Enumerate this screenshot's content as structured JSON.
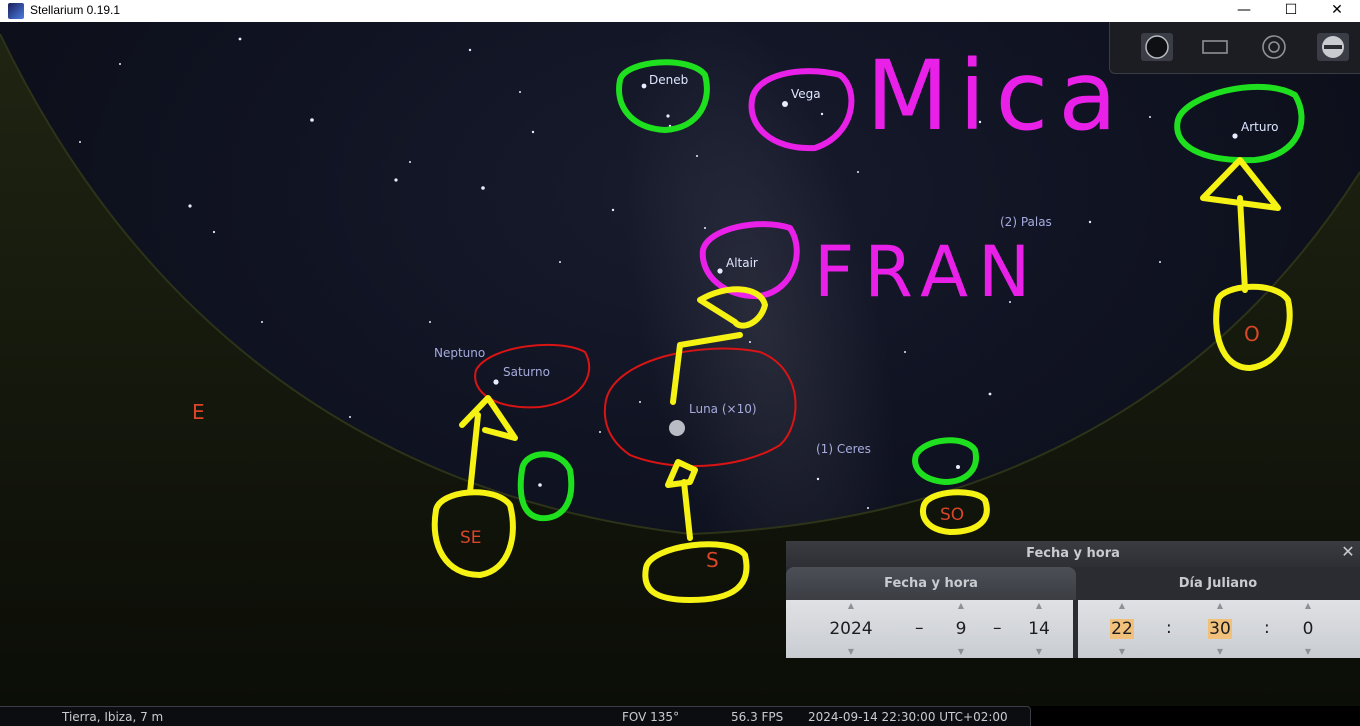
{
  "window": {
    "title": "Stellarium 0.19.1",
    "minimize": "—",
    "maximize": "☐",
    "close": "✕"
  },
  "colors": {
    "sky": "#0f1220",
    "ground": "#14180c",
    "cardinal": "#d9462a",
    "highlight": "#f1c07a"
  },
  "sky_labels": {
    "deneb": "Deneb",
    "vega": "Vega",
    "arturo": "Arturo",
    "palas": "(2) Palas",
    "altair": "Altair",
    "neptuno": "Neptuno",
    "saturno": "Saturno",
    "luna": "Luna (×10)",
    "ceres": "(1) Ceres"
  },
  "cardinals": {
    "e": "E",
    "se": "SE",
    "s": "S",
    "so": "SO",
    "o": "O"
  },
  "handwriting": {
    "mica": "Mica",
    "fran": "FRAN"
  },
  "toolbar": {
    "icons": [
      "sky-view-icon",
      "screen-frame-icon",
      "target-icon",
      "settings-key-icon"
    ]
  },
  "dialog": {
    "title": "Fecha y hora",
    "close": "✕",
    "tab_date": "Fecha y hora",
    "tab_julian": "Día Juliano",
    "year": "2024",
    "month": "9",
    "day": "14",
    "hour": "22",
    "minute": "30",
    "second": "0",
    "date_sep": "–",
    "time_sep": ":",
    "spin_up": "▲",
    "spin_down": "▼"
  },
  "status": {
    "location": "Tierra, Ibiza, 7 m",
    "fov": "FOV 135°",
    "fps": "56.3 FPS",
    "datetime": "2024-09-14 22:30:00 UTC+02:00"
  }
}
